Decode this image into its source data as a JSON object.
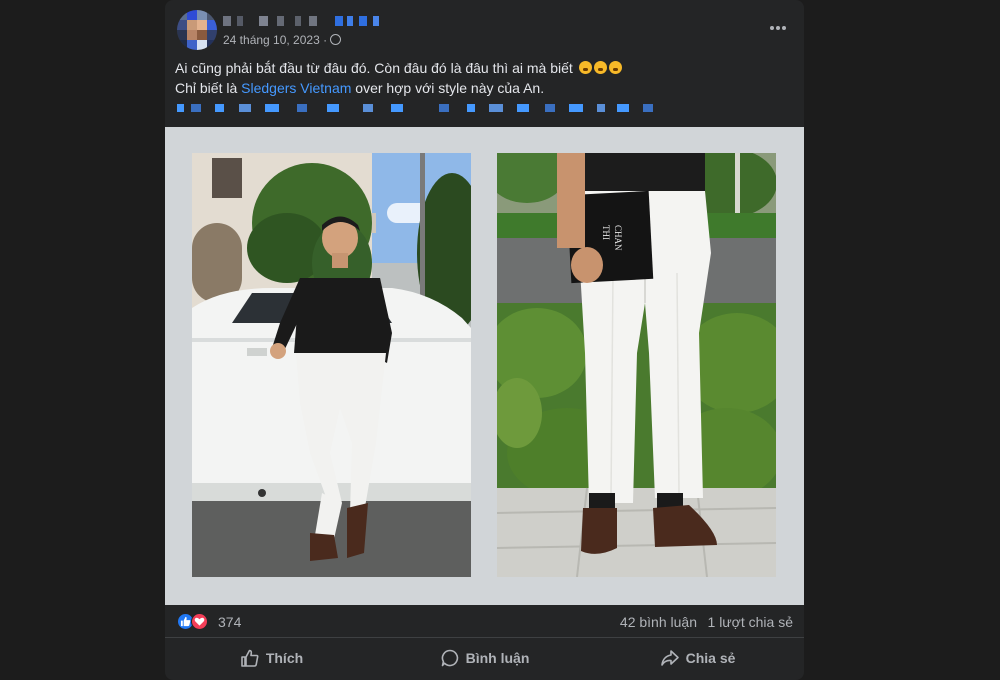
{
  "post": {
    "timestamp": "24 tháng 10, 2023 ·",
    "text_line1": "Ai cũng phải bắt đầu từ đâu đó. Còn đâu đó là đâu thì ai mà biết",
    "text_line2_prefix": "Chỉ biết là ",
    "text_link": "Sledgers Vietnam",
    "text_line2_suffix": " over hợp với style này của An.",
    "emojis": [
      "disappointed-face",
      "disappointed-face",
      "disappointed-face"
    ],
    "photos": [
      {
        "icon": "photo-man-leaning-on-white-car"
      },
      {
        "icon": "photo-white-trousers-closeup"
      }
    ]
  },
  "reactions": {
    "types": [
      "like",
      "love"
    ],
    "count": "374",
    "comments": "42 bình luận",
    "shares": "1 lượt chia sẻ"
  },
  "actions": {
    "like": "Thích",
    "comment": "Bình luận",
    "share": "Chia sẻ"
  },
  "colors": {
    "background": "#1c1c1c",
    "card": "#242526",
    "link": "#4599ff",
    "muted_text": "#b0b3b8",
    "like_blue": "#2078f4",
    "love_red": "#f33e58"
  }
}
